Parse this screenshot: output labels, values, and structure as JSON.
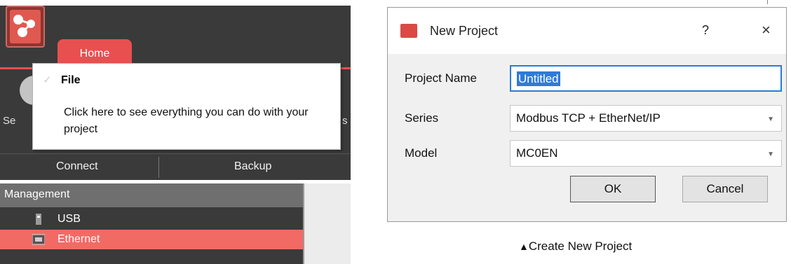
{
  "left_panel": {
    "ribbon": {
      "home_tab": "Home",
      "side_left_fragment": "Se",
      "side_right_fragment": "s",
      "tooltip": {
        "title": "File",
        "body": "Click here to see everything you can do with your project"
      },
      "groups": [
        "Connect",
        "Backup"
      ]
    },
    "management": {
      "header": "Management",
      "items": [
        {
          "label": "USB",
          "icon": "usb-icon",
          "selected": false
        },
        {
          "label": "Ethernet",
          "icon": "ethernet-icon",
          "selected": true
        }
      ]
    },
    "colors": {
      "accent": "#e8504f",
      "selected": "#f26a64",
      "dark": "#3a3a3a"
    }
  },
  "dialog": {
    "title": "New Project",
    "help_glyph": "?",
    "close_glyph": "×",
    "fields": {
      "project_name": {
        "label": "Project Name",
        "value": "Untitled"
      },
      "series": {
        "label": "Series",
        "value": "Modbus TCP + EtherNet/IP"
      },
      "model": {
        "label": "Model",
        "value": "MC0EN"
      }
    },
    "buttons": {
      "ok": "OK",
      "cancel": "Cancel"
    },
    "caption_marker": "▲",
    "caption": "Create New Project"
  }
}
